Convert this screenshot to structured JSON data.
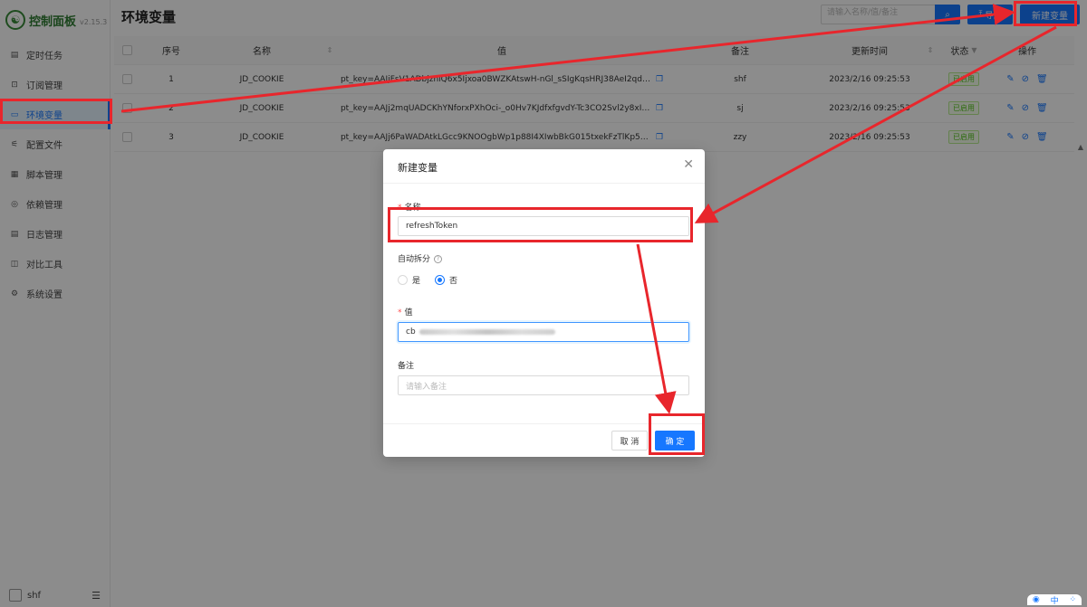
{
  "app": {
    "logo_text": "控制面板",
    "version": "v2.15.3",
    "page_title": "环境变量"
  },
  "sidebar": {
    "items": [
      {
        "label": "定时任务",
        "icon": "calendar-icon",
        "glyph": "▤"
      },
      {
        "label": "订阅管理",
        "icon": "subscription-icon",
        "glyph": "⊡"
      },
      {
        "label": "环境变量",
        "icon": "monitor-icon",
        "glyph": "▭"
      },
      {
        "label": "配置文件",
        "icon": "sliders-icon",
        "glyph": "⚟"
      },
      {
        "label": "脚本管理",
        "icon": "file-code-icon",
        "glyph": "▦"
      },
      {
        "label": "依赖管理",
        "icon": "package-icon",
        "glyph": "◎"
      },
      {
        "label": "日志管理",
        "icon": "log-icon",
        "glyph": "▤"
      },
      {
        "label": "对比工具",
        "icon": "diff-icon",
        "glyph": "◫"
      },
      {
        "label": "系统设置",
        "icon": "gear-icon",
        "glyph": "⚙"
      }
    ],
    "active_index": 2,
    "user": "shf"
  },
  "toolbar": {
    "search_placeholder": "请输入名称/值/备注",
    "import_label": "导入",
    "new_label": "新建变量"
  },
  "table": {
    "headers": {
      "index": "序号",
      "name": "名称",
      "value": "值",
      "remark": "备注",
      "updated": "更新时间",
      "status": "状态",
      "ops": "操作"
    },
    "rows": [
      {
        "index": "1",
        "name": "JD_COOKIE",
        "value": "pt_key=AAJjFsV1ADbjznlQ6x5Ijxoa0BWZKAtswH-nGl_sSIgKqsHRJ38AeI2qdkoN_...",
        "remark": "shf",
        "updated": "2023/2/16 09:25:53",
        "status": "已启用"
      },
      {
        "index": "2",
        "name": "JD_COOKIE",
        "value": "pt_key=AAJj2mqUADCKhYNforxPXhOci-_o0Hv7KJdfxfgvdY-Tc3CO2Svl2y8xIzmM...",
        "remark": "sj",
        "updated": "2023/2/16 09:25:53",
        "status": "已启用"
      },
      {
        "index": "3",
        "name": "JD_COOKIE",
        "value": "pt_key=AAJj6PaWADAtkLGcc9KNOOgbWp1p88I4XIwbBkG015txekFzTlKp51-IjaE...",
        "remark": "zzy",
        "updated": "2023/2/16 09:25:53",
        "status": "已启用"
      }
    ]
  },
  "modal": {
    "title": "新建变量",
    "name_label": "名称",
    "name_value": "refreshToken",
    "split_label": "自动拆分",
    "split_options": [
      "是",
      "否"
    ],
    "split_selected": 1,
    "value_label": "值",
    "value_prefix": "cb",
    "remark_label": "备注",
    "remark_placeholder": "请输入备注",
    "cancel_label": "取 消",
    "ok_label": "确 定"
  },
  "ime": {
    "label": "中"
  },
  "colors": {
    "primary": "#1677ff",
    "annotation": "#e8262c",
    "success": "#52c41a",
    "logo": "#2f7d32"
  }
}
